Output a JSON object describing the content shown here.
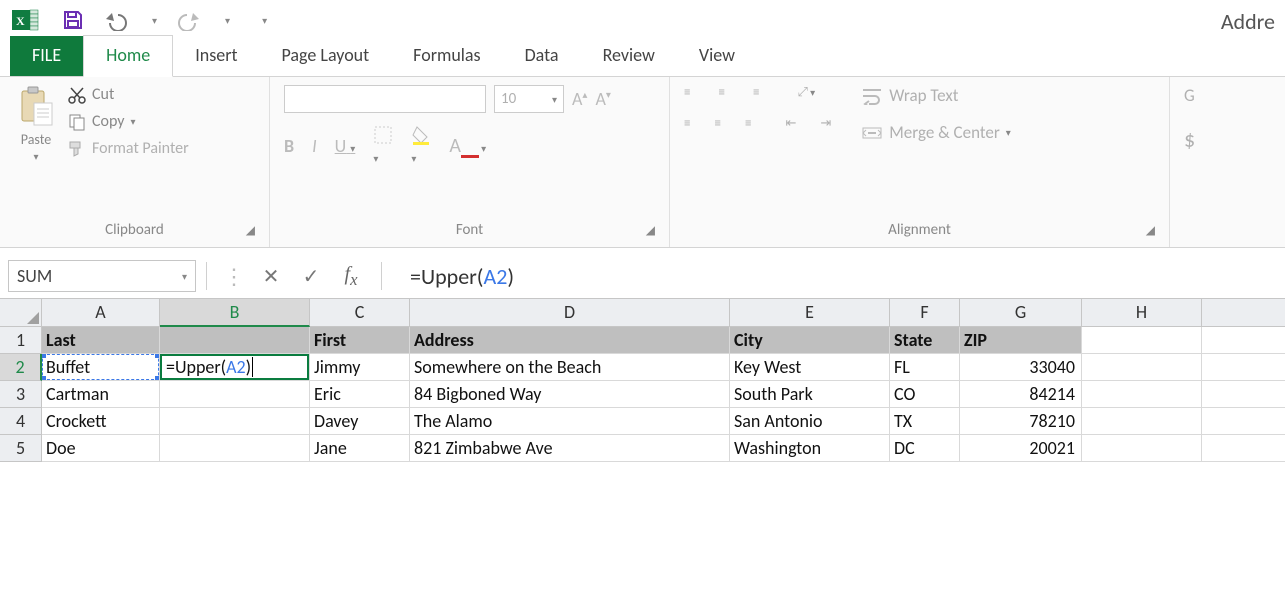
{
  "title": "Addre",
  "tabs": {
    "file": "FILE",
    "home": "Home",
    "insert": "Insert",
    "page_layout": "Page Layout",
    "formulas": "Formulas",
    "data": "Data",
    "review": "Review",
    "view": "View"
  },
  "clipboard": {
    "paste": "Paste",
    "cut": "Cut",
    "copy": "Copy",
    "format_painter": "Format Painter",
    "group_label": "Clipboard"
  },
  "font": {
    "size": "10",
    "bold": "B",
    "italic": "I",
    "underline": "U",
    "font_letter": "A",
    "group_label": "Font"
  },
  "alignment": {
    "wrap": "Wrap Text",
    "merge": "Merge & Center",
    "group_label": "Alignment"
  },
  "number_group_hint": "G",
  "formula_bar": {
    "name_box": "SUM",
    "formula_prefix": "=Upper(",
    "formula_ref": "A2",
    "formula_suffix": ")"
  },
  "columns": [
    "A",
    "B",
    "C",
    "D",
    "E",
    "F",
    "G",
    "H",
    ""
  ],
  "headers": {
    "A": "Last",
    "B": "",
    "C": "First",
    "D": "Address",
    "E": "City",
    "F": "State",
    "G": "ZIP",
    "H": "",
    "I": ""
  },
  "rows": [
    {
      "n": "1"
    },
    {
      "n": "2",
      "A": "Buffet",
      "B_editing_prefix": "=Upper(",
      "B_editing_ref": "A2",
      "B_editing_suffix": ")",
      "C": "Jimmy",
      "D": "Somewhere on the Beach",
      "E": "Key West",
      "F": "FL",
      "G": "33040"
    },
    {
      "n": "3",
      "A": "Cartman",
      "C": "Eric",
      "D": "84 Bigboned Way",
      "E": "South Park",
      "F": "CO",
      "G": "84214"
    },
    {
      "n": "4",
      "A": "Crockett",
      "C": "Davey",
      "D": "The Alamo",
      "E": "San Antonio",
      "F": "TX",
      "G": "78210"
    },
    {
      "n": "5",
      "A": "Doe",
      "C": "Jane",
      "D": "821 Zimbabwe Ave",
      "E": "Washington",
      "F": "DC",
      "G": "20021"
    }
  ]
}
